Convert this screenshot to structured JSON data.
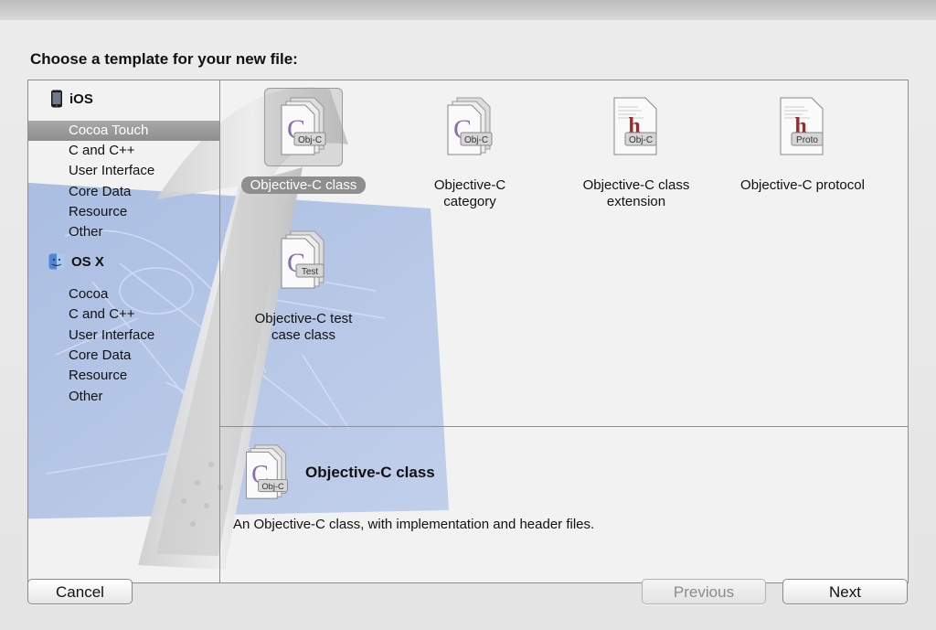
{
  "dialog": {
    "title": "Choose a template for your new file:"
  },
  "sidebar": {
    "groups": [
      {
        "name": "iOS",
        "icon": "iphone-icon",
        "items": [
          {
            "label": "Cocoa Touch",
            "selected": true
          },
          {
            "label": "C and C++"
          },
          {
            "label": "User Interface"
          },
          {
            "label": "Core Data"
          },
          {
            "label": "Resource"
          },
          {
            "label": "Other"
          }
        ]
      },
      {
        "name": "OS X",
        "icon": "finder-icon",
        "items": [
          {
            "label": "Cocoa"
          },
          {
            "label": "C and C++"
          },
          {
            "label": "User Interface"
          },
          {
            "label": "Core Data"
          },
          {
            "label": "Resource"
          },
          {
            "label": "Other"
          }
        ]
      }
    ]
  },
  "templates": [
    {
      "label_line1": "Objective-C class",
      "label_line2": "",
      "badge": "Obj-C",
      "glyph": "C",
      "selected": true
    },
    {
      "label_line1": "Objective-C",
      "label_line2": "category",
      "badge": "Obj-C",
      "glyph": "C"
    },
    {
      "label_line1": "Objective-C class",
      "label_line2": "extension",
      "badge": "Obj-C",
      "glyph": "h"
    },
    {
      "label_line1": "Objective-C protocol",
      "label_line2": "",
      "badge": "Proto",
      "glyph": "h"
    },
    {
      "label_line1": "Objective-C test",
      "label_line2": "case class",
      "badge": "Test",
      "glyph": "C"
    }
  ],
  "detail": {
    "title": "Objective-C class",
    "badge": "Obj-C",
    "glyph": "C",
    "description": "An Objective-C class, with implementation and header files."
  },
  "buttons": {
    "cancel": "Cancel",
    "previous": "Previous",
    "next": "Next"
  },
  "colors": {
    "selection_gray": "#8e8e8e",
    "class_glyph": "#8a6fb0",
    "header_glyph": "#9b2b2b"
  }
}
